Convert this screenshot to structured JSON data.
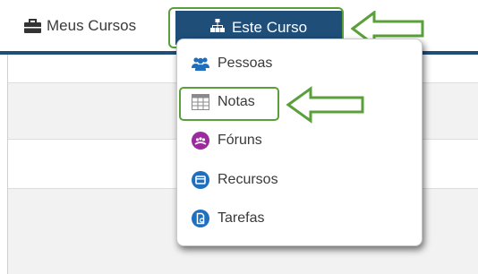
{
  "nav": {
    "meus_cursos": "Meus Cursos",
    "este_curso": "Este Curso"
  },
  "menu": {
    "items": [
      {
        "label": "Pessoas",
        "icon": "people-icon"
      },
      {
        "label": "Notas",
        "icon": "grade-table-icon"
      },
      {
        "label": "Fóruns",
        "icon": "forum-icon"
      },
      {
        "label": "Recursos",
        "icon": "resource-icon"
      },
      {
        "label": "Tarefas",
        "icon": "assignment-icon"
      }
    ]
  },
  "colors": {
    "navbar_accent": "#1f4e79",
    "highlight_green": "#5aa03a",
    "forum_purple": "#9b2a9e",
    "icon_blue": "#1f6fbf"
  }
}
